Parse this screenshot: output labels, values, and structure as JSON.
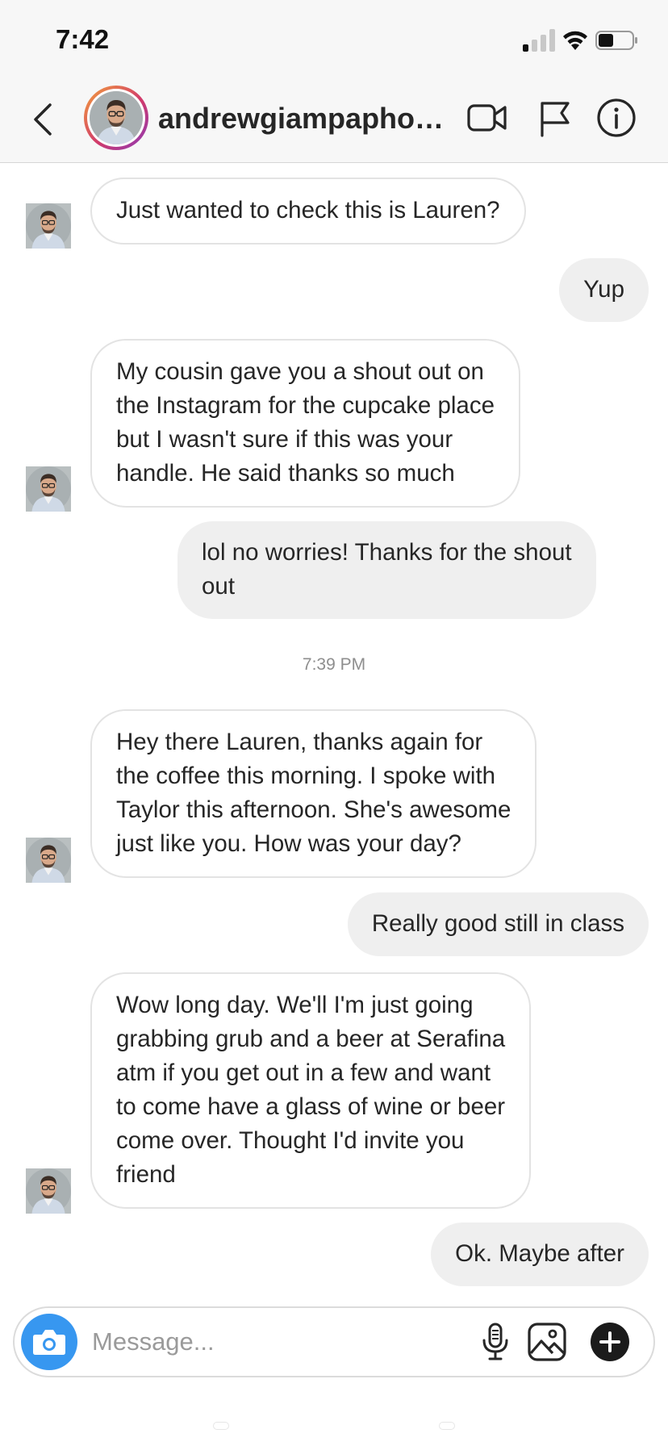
{
  "status_bar": {
    "time": "7:42",
    "signal_icon": "cellular-signal-icon",
    "wifi_icon": "wifi-icon",
    "battery_icon": "battery-icon"
  },
  "header": {
    "back_icon": "chevron-left-icon",
    "username": "andrewgiampaphoto...",
    "video_icon": "video-camera-icon",
    "flag_icon": "flag-icon",
    "info_icon": "info-icon"
  },
  "messages": [
    {
      "from": "them",
      "lines": [
        "Just wanted to check this is Lauren?"
      ]
    },
    {
      "from": "me",
      "lines": [
        "Yup"
      ]
    },
    {
      "from": "them",
      "lines": [
        "My cousin gave you a shout out on",
        "the Instagram for the cupcake place",
        "but I wasn't sure if this was your",
        "handle. He said thanks so much"
      ]
    },
    {
      "from": "me",
      "lines": [
        "lol no worries! Thanks for the shout",
        "out"
      ]
    },
    {
      "from": "them",
      "lines": [
        "Hey there Lauren, thanks again for",
        "the coffee this morning. I spoke with",
        "Taylor this afternoon. She's awesome",
        "just like you. How was your day?"
      ]
    },
    {
      "from": "me",
      "lines": [
        "Really good still in class"
      ]
    },
    {
      "from": "them",
      "lines": [
        "Wow long day. We'll I'm just going",
        "grabbing grub and a beer at Serafina",
        "atm if you get out in a few and want",
        "to come have a glass of wine or beer",
        "come over. Thought I'd invite you",
        "friend"
      ]
    },
    {
      "from": "me",
      "lines": [
        "Ok. Maybe after"
      ]
    }
  ],
  "timestamp": "7:39 PM",
  "composer": {
    "placeholder": "Message...",
    "camera_icon": "camera-icon",
    "mic_icon": "microphone-icon",
    "gallery_icon": "image-gallery-icon",
    "plus_icon": "plus-icon"
  },
  "colors": {
    "accent_blue": "#3797f0",
    "incoming_border": "#e3e3e3",
    "outgoing_bg": "#efefef",
    "text": "#262626",
    "muted": "#8e8e8e"
  }
}
